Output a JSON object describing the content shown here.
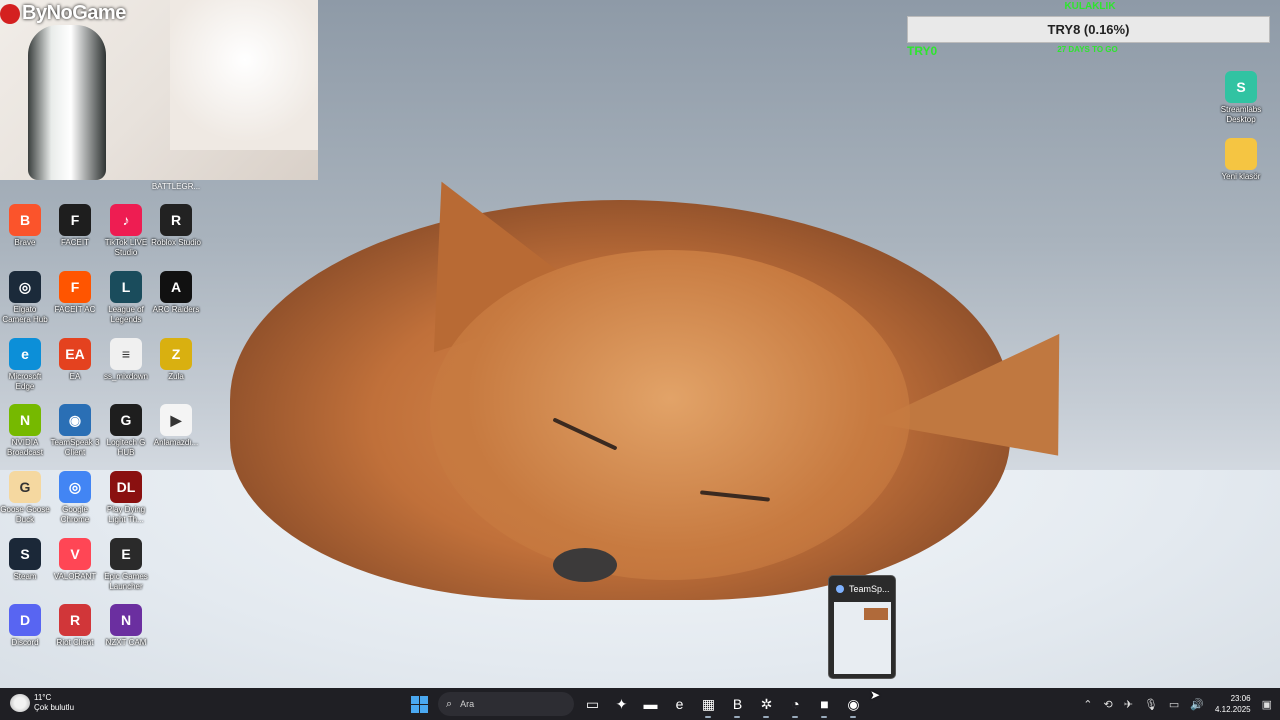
{
  "overlay": {
    "brand_name": "ByNoGame",
    "goal_title": "KULAKLIK",
    "goal_progress_text": "TRY8 (0.16%)",
    "goal_progress_fraction": 0.0016,
    "goal_left": "TRY0",
    "goal_days": "27 DAYS TO GO"
  },
  "desktop": {
    "cut_label": "BATTLEGR...",
    "icons": [
      {
        "label": "Brave",
        "icon": "brave-icon",
        "color": "#fb542b",
        "glyph": "B"
      },
      {
        "label": "FACEIT",
        "icon": "faceit-icon",
        "color": "#1e1e1e",
        "glyph": "F"
      },
      {
        "label": "TikTok LIVE Studio",
        "icon": "tiktok-icon",
        "color": "#ee1d52",
        "glyph": "♪"
      },
      {
        "label": "Roblox Studio",
        "icon": "roblox-icon",
        "color": "#222222",
        "glyph": "R"
      },
      {
        "label": "Elgato Camera Hub",
        "icon": "elgato-icon",
        "color": "#1b2a3a",
        "glyph": "◎"
      },
      {
        "label": "FACEIT AC",
        "icon": "faceit-ac-icon",
        "color": "#ff5500",
        "glyph": "F"
      },
      {
        "label": "League of Legends",
        "icon": "league-icon",
        "color": "#1a4c5c",
        "glyph": "L"
      },
      {
        "label": "ARC Raiders",
        "icon": "arc-raiders-icon",
        "color": "#111111",
        "glyph": "A"
      },
      {
        "label": "Microsoft Edge",
        "icon": "edge-icon",
        "color": "#0c8fd8",
        "glyph": "e"
      },
      {
        "label": "EA",
        "icon": "ea-icon",
        "color": "#e4421f",
        "glyph": "EA"
      },
      {
        "label": "ss_mixdown",
        "icon": "audio-file-icon",
        "color": "#f0f0f0",
        "glyph": "≡"
      },
      {
        "label": "Zula",
        "icon": "zula-icon",
        "color": "#d9b010",
        "glyph": "Z"
      },
      {
        "label": "NVIDIA Broadcast",
        "icon": "nvidia-icon",
        "color": "#76b900",
        "glyph": "N"
      },
      {
        "label": "TeamSpeak 3 Client",
        "icon": "teamspeak-icon",
        "color": "#2a6fb5",
        "glyph": "◉"
      },
      {
        "label": "Logitech G HUB",
        "icon": "logitech-icon",
        "color": "#1e1e1e",
        "glyph": "G"
      },
      {
        "label": "Anlamazdı...",
        "icon": "video-file-icon",
        "color": "#f4f4f4",
        "glyph": "▶"
      },
      {
        "label": "Goose Goose Duck",
        "icon": "goose-icon",
        "color": "#f5d8a0",
        "glyph": "G"
      },
      {
        "label": "Google Chrome",
        "icon": "chrome-icon",
        "color": "#4285f4",
        "glyph": "◎"
      },
      {
        "label": "Play Dying Light Th...",
        "icon": "dying-light-icon",
        "color": "#8a1010",
        "glyph": "DL"
      },
      {
        "label": "Steam",
        "icon": "steam-icon",
        "color": "#1b2838",
        "glyph": "S"
      },
      {
        "label": "VALORANT",
        "icon": "valorant-icon",
        "color": "#ff4655",
        "glyph": "V"
      },
      {
        "label": "Epic Games Launcher",
        "icon": "epic-icon",
        "color": "#2a2a2a",
        "glyph": "E"
      },
      {
        "label": "Discord",
        "icon": "discord-icon",
        "color": "#5865f2",
        "glyph": "D"
      },
      {
        "label": "Riot Client",
        "icon": "riot-icon",
        "color": "#d13639",
        "glyph": "R"
      },
      {
        "label": "NZXT CAM",
        "icon": "nzxt-icon",
        "color": "#6b2fa0",
        "glyph": "N"
      },
      {
        "label": "Streamlabs Desktop",
        "icon": "streamlabs-icon",
        "color": "#31c3a2",
        "glyph": "S"
      },
      {
        "label": "Yeni klasör",
        "icon": "folder-icon",
        "color": "#f5c542",
        "glyph": ""
      }
    ]
  },
  "preview": {
    "title": "TeamSp..."
  },
  "taskbar": {
    "weather_temp": "11°C",
    "weather_desc": "Çok bulutlu",
    "search_placeholder": "Ara",
    "time": "23:06",
    "date": "4.12.2025",
    "apps": [
      {
        "name": "task-view-icon",
        "glyph": "▭"
      },
      {
        "name": "copilot-icon",
        "glyph": "✦"
      },
      {
        "name": "file-explorer-icon",
        "glyph": "▬"
      },
      {
        "name": "edge-taskbar-icon",
        "glyph": "e"
      },
      {
        "name": "store-icon",
        "glyph": "▦"
      },
      {
        "name": "brave-taskbar-icon",
        "glyph": "B"
      },
      {
        "name": "settings-taskbar-icon",
        "glyph": "✲"
      },
      {
        "name": "obs-taskbar-icon",
        "glyph": "◔"
      },
      {
        "name": "minecraft-taskbar-icon",
        "glyph": "■"
      },
      {
        "name": "teamspeak-taskbar-icon",
        "glyph": "◉"
      }
    ],
    "tray_icons": [
      "chevron-up-icon",
      "sync-icon",
      "network-off-icon",
      "microphone-icon",
      "display-icon",
      "volume-icon"
    ]
  }
}
